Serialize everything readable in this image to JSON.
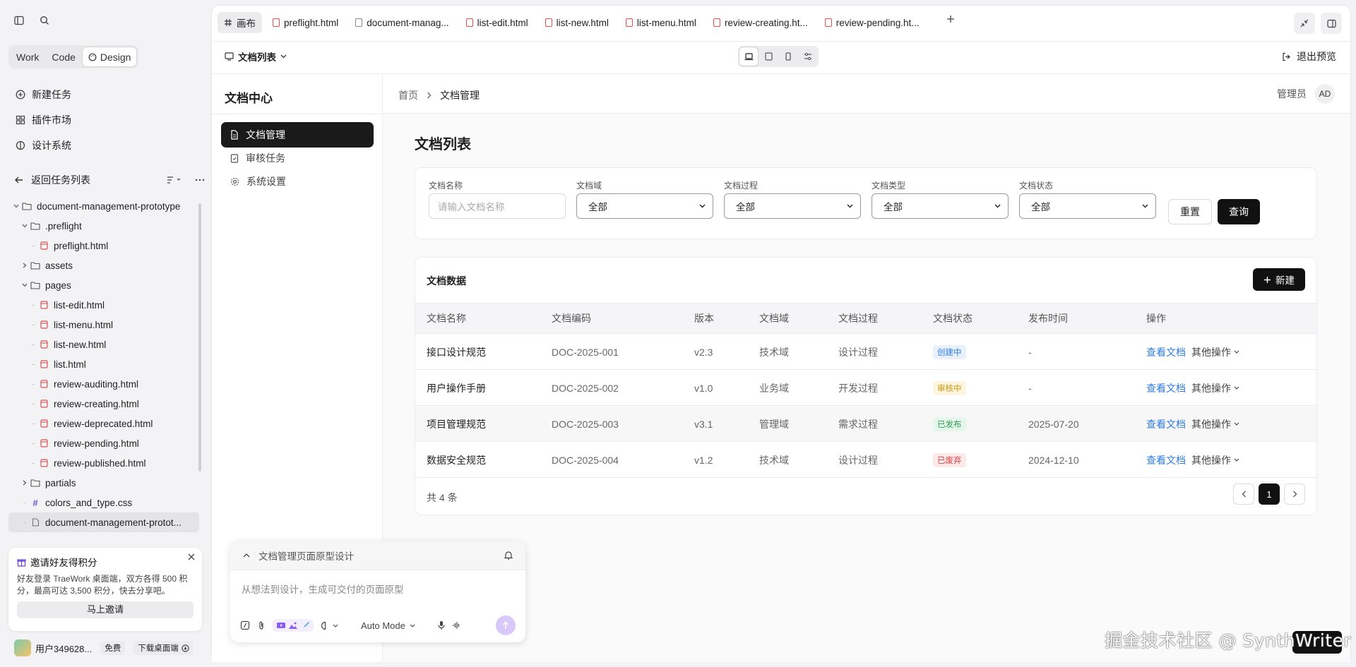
{
  "left": {
    "modes": [
      "Work",
      "Code",
      "Design"
    ],
    "nav": [
      "新建任务",
      "插件市场",
      "设计系统"
    ],
    "back_label": "返回任务列表",
    "tree": [
      {
        "label": "document-management-prototype",
        "level": 0,
        "type": "folder",
        "open": true
      },
      {
        "label": ".preflight",
        "level": 1,
        "type": "folder",
        "open": true
      },
      {
        "label": "preflight.html",
        "level": 2,
        "type": "html"
      },
      {
        "label": "assets",
        "level": 1,
        "type": "folder",
        "open": false
      },
      {
        "label": "pages",
        "level": 1,
        "type": "folder",
        "open": true
      },
      {
        "label": "list-edit.html",
        "level": 2,
        "type": "html"
      },
      {
        "label": "list-menu.html",
        "level": 2,
        "type": "html"
      },
      {
        "label": "list-new.html",
        "level": 2,
        "type": "html"
      },
      {
        "label": "list.html",
        "level": 2,
        "type": "html"
      },
      {
        "label": "review-auditing.html",
        "level": 2,
        "type": "html"
      },
      {
        "label": "review-creating.html",
        "level": 2,
        "type": "html"
      },
      {
        "label": "review-deprecated.html",
        "level": 2,
        "type": "html"
      },
      {
        "label": "review-pending.html",
        "level": 2,
        "type": "html"
      },
      {
        "label": "review-published.html",
        "level": 2,
        "type": "html"
      },
      {
        "label": "partials",
        "level": 1,
        "type": "folder",
        "open": false
      },
      {
        "label": "colors_and_type.css",
        "level": 1,
        "type": "css"
      },
      {
        "label": "document-management-protot...",
        "level": 1,
        "type": "doc",
        "selected": true
      }
    ],
    "invite": {
      "title": "邀请好友得积分",
      "desc": "好友登录 TraeWork 桌面端，双方各得 500 积分，最高可达 3,500 积分，快去分享吧。",
      "button": "马上邀请"
    },
    "user": {
      "name": "用户349628...",
      "plan": "免费",
      "download": "下载桌面端"
    }
  },
  "tabs": [
    {
      "label": "画布",
      "type": "canvas",
      "active": true
    },
    {
      "label": "preflight.html",
      "type": "html"
    },
    {
      "label": "document-manag...",
      "type": "doc"
    },
    {
      "label": "list-edit.html",
      "type": "html"
    },
    {
      "label": "list-new.html",
      "type": "html"
    },
    {
      "label": "list-menu.html",
      "type": "html"
    },
    {
      "label": "review-creating.ht...",
      "type": "html"
    },
    {
      "label": "review-pending.ht...",
      "type": "html"
    }
  ],
  "toolbar": {
    "page_select": "文档列表",
    "exit_preview": "退出预览"
  },
  "app": {
    "brand": "文档中心",
    "side_nav": [
      "文档管理",
      "审核任务",
      "系统设置"
    ],
    "breadcrumb": [
      "首页",
      "文档管理"
    ],
    "user_role": "管理员",
    "avatar": "AD",
    "page_title": "文档列表",
    "filters": {
      "name_label": "文档名称",
      "name_placeholder": "请输入文档名称",
      "domain_label": "文档域",
      "process_label": "文档过程",
      "type_label": "文档类型",
      "status_label": "文档状态",
      "all": "全部",
      "reset": "重置",
      "query": "查询"
    },
    "table": {
      "title": "文档数据",
      "new_button": "新建",
      "columns": [
        "文档名称",
        "文档编码",
        "版本",
        "文档域",
        "文档过程",
        "文档状态",
        "发布时间",
        "操作"
      ],
      "rows": [
        {
          "name": "接口设计规范",
          "code": "DOC-2025-001",
          "version": "v2.3",
          "domain": "技术域",
          "process": "设计过程",
          "status": "创建中",
          "status_color": "#2f7de1",
          "date": "-"
        },
        {
          "name": "用户操作手册",
          "code": "DOC-2025-002",
          "version": "v1.0",
          "domain": "业务域",
          "process": "开发过程",
          "status": "审核中",
          "status_color": "#c99a0e",
          "date": "-"
        },
        {
          "name": "项目管理规范",
          "code": "DOC-2025-003",
          "version": "v3.1",
          "domain": "管理域",
          "process": "需求过程",
          "status": "已发布",
          "status_color": "#2e9e52",
          "date": "2025-07-20"
        },
        {
          "name": "数据安全规范",
          "code": "DOC-2025-004",
          "version": "v1.2",
          "domain": "技术域",
          "process": "设计过程",
          "status": "已废弃",
          "status_color": "#d94141",
          "date": "2024-12-10"
        }
      ],
      "view_link": "查看文档",
      "more_ops": "其他操作",
      "total": "共 4 条",
      "current_page": "1"
    }
  },
  "chat": {
    "title": "文档管理页面原型设计",
    "placeholder": "从想法到设计，生成可交付的页面原型",
    "mode": "Auto Mode"
  },
  "watermark": "掘金技术社区 @ SynthWriter"
}
